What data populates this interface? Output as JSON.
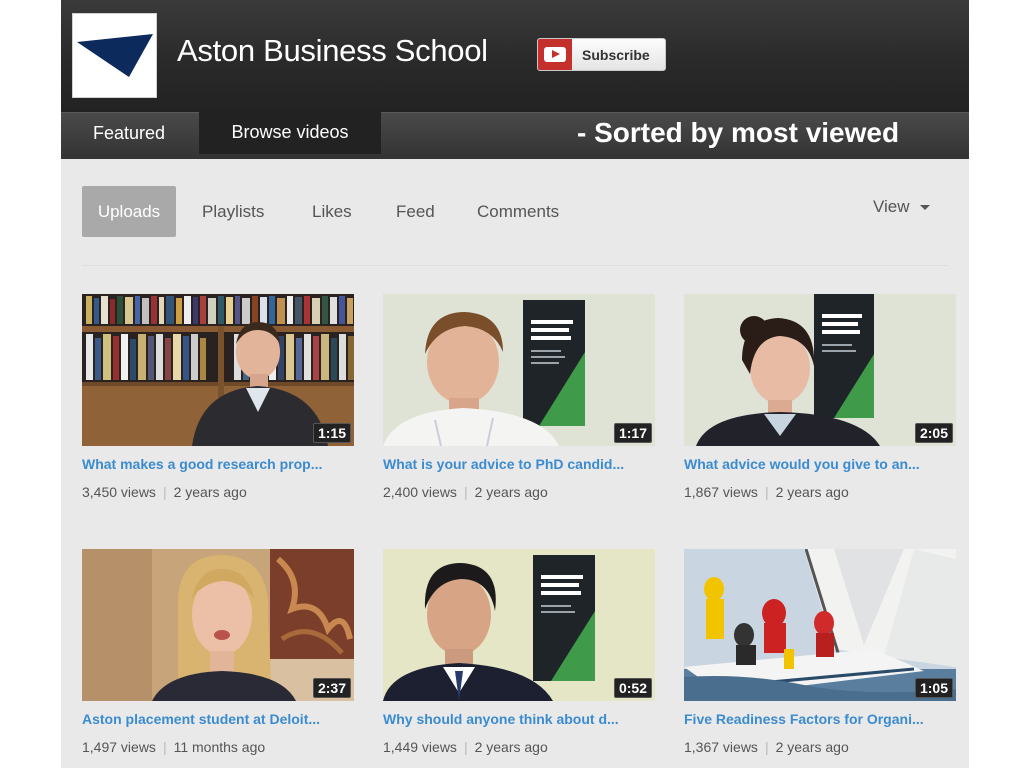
{
  "channel": {
    "title": "Aston Business School",
    "subscribe_label": "Subscribe"
  },
  "tabs": [
    {
      "label": "Featured",
      "selected": false
    },
    {
      "label": "Browse videos",
      "selected": true
    }
  ],
  "sorted_note": "- Sorted by most viewed",
  "subnav": {
    "items": [
      {
        "label": "Uploads",
        "selected": true
      },
      {
        "label": "Playlists",
        "selected": false
      },
      {
        "label": "Likes",
        "selected": false
      },
      {
        "label": "Feed",
        "selected": false
      },
      {
        "label": "Comments",
        "selected": false
      }
    ],
    "view_label": "View"
  },
  "videos": [
    {
      "title": "What makes a good research prop...",
      "duration": "1:15",
      "views": "3,450 views",
      "age": "2 years ago"
    },
    {
      "title": "What is your advice to PhD candid...",
      "duration": "1:17",
      "views": "2,400 views",
      "age": "2 years ago"
    },
    {
      "title": "What advice would you give to an...",
      "duration": "2:05",
      "views": "1,867 views",
      "age": "2 years ago"
    },
    {
      "title": "Aston placement student at Deloit...",
      "duration": "2:37",
      "views": "1,497 views",
      "age": "11 months ago"
    },
    {
      "title": "Why should anyone think about d...",
      "duration": "0:52",
      "views": "1,449 views",
      "age": "2 years ago"
    },
    {
      "title": "Five Readiness Factors for Organi...",
      "duration": "1:05",
      "views": "1,367 views",
      "age": "2 years ago"
    }
  ],
  "colors": {
    "link": "#3b8bd0",
    "header_bg": "#2a2a2a",
    "subscribe_red": "#c4302b",
    "page_bg": "#e9e9e9"
  }
}
